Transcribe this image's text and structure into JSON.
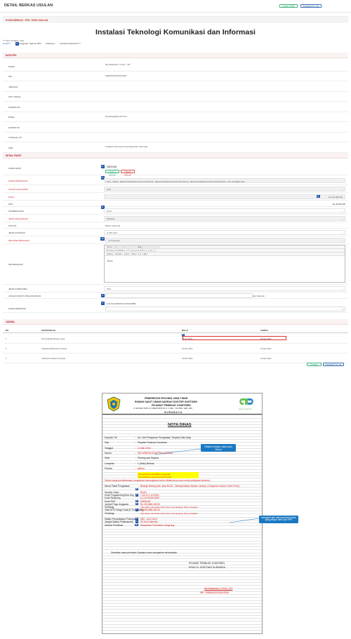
{
  "header": {
    "title": "DETAIL BERKAS USULAN",
    "btn_cetak": "Cetak DRAF",
    "btn_kembali": "Kembali Ke List"
  },
  "position": "POSISI BERKAS : PPK / DRAF USULAN",
  "main_title": "Instalasi Teknologi Komunikasi dan Informasi",
  "required_note": "*** Perlu Tindakan / aksi",
  "tabs": [
    "Detail***",
    "Anggaran, Spek & HPS",
    "Dokumen",
    "Lampiran Dokumen***"
  ],
  "data_ppk": {
    "heading": "DATA PPK",
    "rows": [
      {
        "label": "NAMA",
        "value": "Ika Wulandari, S.Kom., MT"
      },
      {
        "label": "NIP",
        "value": "198606152015012009"
      },
      {
        "label": "JABATAN",
        "value": ""
      },
      {
        "label": "UNIT KERJA",
        "value": ""
      },
      {
        "label": "NOMOR HP",
        "value": ""
      },
      {
        "label": "EMAIL",
        "value": "ikawulaya@Gmail.Com"
      },
      {
        "label": "NOMOR SK",
        "value": ""
      },
      {
        "label": "TANGGAL SK",
        "value": ""
      },
      {
        "label": "KPB",
        "value": "Instalasi Teknologi Komunikasi Dan Informasi"
      }
    ]
  },
  "detail_paket": {
    "heading": "DETAIL PAKET",
    "kode_grup_label": "KODE GRUP",
    "kode_grup_value": "50820436",
    "btn_lihat": "Lihat Di SIRUP",
    "btn_hapus": "Hapus SIRUP",
    "nama_pekerjaan_label": "NAMA PEKERJAAN",
    "nama_pekerjaan_value": "RSU - IPRSK - BELANJA BARANG DAN JASA BLUD - BELANJA BARANG DAN JASA BLUD - BELANJA BARANG DAN KONSTRUKSI - (PT. KONSER, BLL)",
    "tahun_label": "TAHUN ANGGARAN",
    "tahun_value": "2024",
    "pagu_label": "PAGU",
    "pagu_value": "Rp.392.888.400",
    "hps_label": "HPS",
    "hps_value": "Rp.28.000.000",
    "sumber_dana_label": "SUMBER DANA",
    "sumber_dana_value": "BLUD",
    "jenis_label": "JENIS PENGADAAN",
    "jenis_value": "BARANG",
    "status_label": "STATUS",
    "status_value": "DRAF USULAN",
    "jenis_kontrak_label": "JENIS KONTRAK",
    "jenis_kontrak_value": "LUMP SUM",
    "metode_label": "METODE PEMILIHAN",
    "metode_value": "e-Purchasing",
    "keterangan_label": "KETERANGAN",
    "editor_toolbar_1": "Source  ▢ ⎘ ▢ ▢  ✂ ⎘ ▢ ▢ ▢  ↶ ↷  ⌕ ⇆ ▦  ▢ ▢ ▢ ▢ ▢ ▢ ▢ ▢",
    "editor_toolbar_2": "B I U S x₂ x²  Ix  ≔ ≔ ⇤ ⇥ ❝ ▢  ≡ ≡ ≡ ≡  ⚲ ⚲ ⚑  ▢ ▢ ▢ Ω ▢ ▢",
    "editor_styles": "Styles",
    "editor_format": "Format",
    "editor_font": "Font",
    "editor_size": "Size",
    "editor_text": "Ricck",
    "jenis_komponen_label": "JENIS KOMPONEN",
    "jenis_komponen_value": "PDN",
    "jangka_label": "JANGKA WAKTU PELAKSANAAN",
    "jangka_unit": "Hari Kalender",
    "kode_rekening_label": "KODE REKENING",
    "kode_rekening_value": "1.02.01.10.009.51.02.00.00.9999"
  },
  "jadwal": {
    "heading": "JADWAL",
    "columns": [
      "NO",
      "KETERANGAN",
      "MULAI",
      "SAMPAI"
    ],
    "rows": [
      [
        "1",
        "Pemanfaatan Barang Jasa",
        "01 Apr 2024",
        "30 Mei 2024"
      ],
      [
        "2",
        "Jadwal Pelaksanaan Kontrak",
        "01 Mei 2024",
        "01 Mei 2024"
      ],
      [
        "3",
        "Jadwal Pemilihan Penyedia",
        "01 Mei 2024",
        "01 Mei 2024"
      ]
    ],
    "btn_simpan": "Simpan",
    "btn_kembali": "Kembali Ke List"
  },
  "doc": {
    "gov": "PEMERINTAH PROVINSI JAWA TIMUR",
    "rs": "RUMAH SAKIT UMUM DAERAH DOKTER SOETOMO",
    "ppk": "PEJABAT PEMBUAT KOMITMEN",
    "addr": "Jl. MAYJEN. PROF. Dr. MOESTOPO NO. 6 - 8 Telp. : 031 5501, 1188, 1391",
    "city": "S U R A B A Y A",
    "logo_right": "RSUD DR. SOETOMO",
    "title": "NOTA DINAS",
    "fields": [
      {
        "k": "Kepada Yth.",
        "v": "Ka. Unit Pelayanan Pengadaan Terpadu Satu Atap"
      },
      {
        "k": "Dari",
        "v": "Pejabat Pembuat Komitmen"
      },
      {
        "k": "Tanggal",
        "v": "14 Mei 2024"
      },
      {
        "k": "Nomor",
        "v": "000.3/3603/102.6/PPKom/2/2024"
      },
      {
        "k": "Sifat",
        "v": "Penting dan Segera"
      },
      {
        "k": "Lampiran",
        "v": "1 (Satu) Berkas"
      },
      {
        "k": "Perihal",
        "v": "pilihan"
      }
    ],
    "perihal_opt1": "Permohonan pemilihan penyedia",
    "perihal_opt2": "Permohonan penyusunan Kontrak",
    "intro": "Dalam rangka pelaksanaan pengadaan barang/jasa mohon dilakukan proses untuk pekerjaan tersebut :",
    "details": [
      {
        "k": "Nama Paket Pengadaan",
        "v": "Belanja Barang dan Jasa BLUD - Belanja Bahan Bahan Lainnya ( Komponen Above Knee Prost )"
      },
      {
        "k": "Sumber Dana",
        "v": "BLUD"
      },
      {
        "k": "Kode Program/Keg/Sub Keg",
        "v": "1.02.01.1.10.0001"
      },
      {
        "k": "Kode Rekening",
        "v": "5.1.02.99.99.9999"
      },
      {
        "k": "Kode RUP",
        "v": "53635161"
      },
      {
        "k": "Jumlah Pagu Anggaran",
        "v": "Rp      392,888,400.00"
      },
      {
        "k": "Terbilang",
        "v": "Tiga Ratus Sembilan Puluh Dua Juta Delapan Ratus Delapan"
      },
      {
        "k": "Total HPS /Harga Total (E-Purchasing)",
        "v": "Rp      392,888,400.00"
      },
      {
        "k": "Terbilang",
        "v": "Tiga Ratus Sembilan Puluh Dua Juta Delapan Ratus Delapan"
      },
      {
        "k": "Waktu Pemanfaatan Pekerjaan",
        "v": "MEI - JULI 2024"
      },
      {
        "k": "Jangka Waktu Pelaksanaan",
        "v": "90 Hari Kalender"
      },
      {
        "k": "Metode Pemilihan",
        "v": "Dilanjutkan Pembelian Langsung"
      }
    ],
    "closing": "Demikian atas perhatian Saudara kami sampaikan terimakasih.",
    "sign1": "PEJABAT PEMBUAT KOMITMEN",
    "sign2": "RSUD Dr. SOETOMO SURABAYA",
    "sign_name": "Ika Wulandari, S.Kom., MT",
    "sign_nip": "NIP. 198606152015012009"
  },
  "annotations": {
    "nomor": "Diisikan entryan untuk input Nomor",
    "total": "mengikuti dari nilai total dari rincian yang diinput oleh user PPK"
  },
  "colors": {
    "accent": "#2255aa",
    "danger": "#b01e2b",
    "success": "#3bb27d"
  }
}
